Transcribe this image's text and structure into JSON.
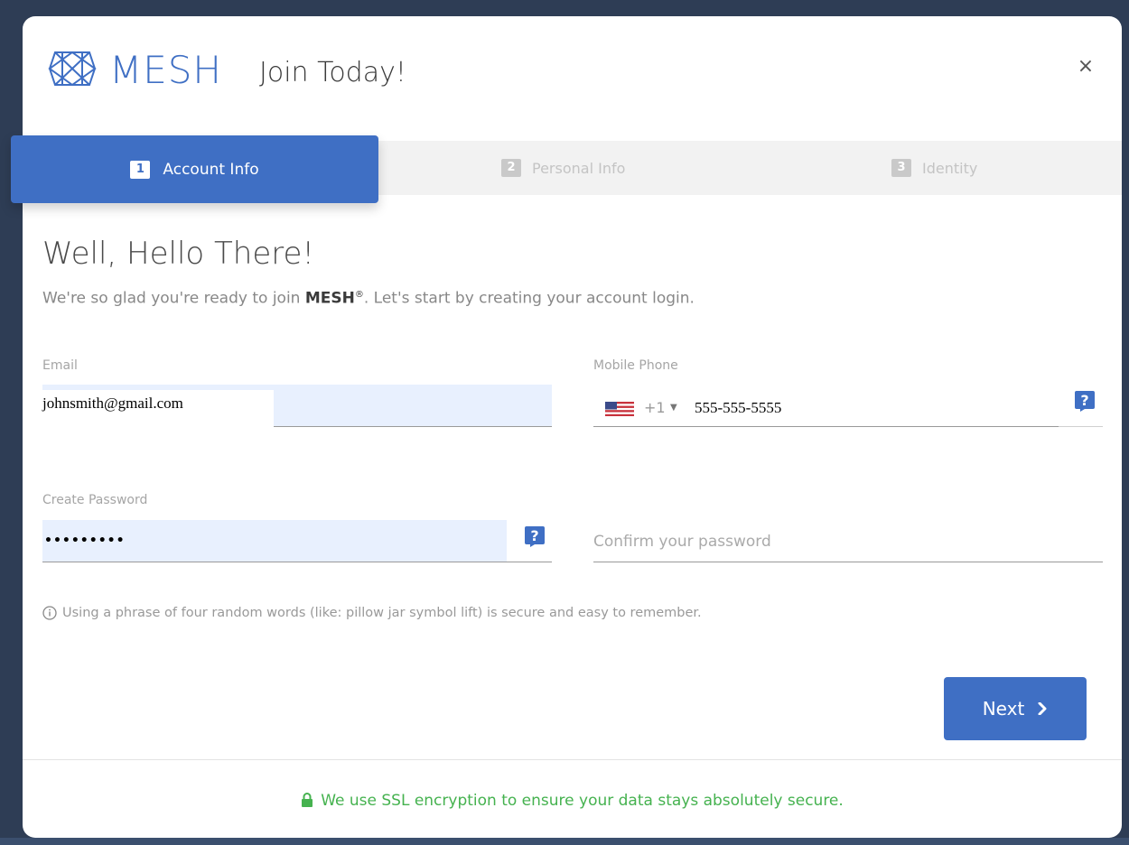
{
  "header": {
    "brand": "MESH",
    "title": "Join Today!",
    "close_label": "×"
  },
  "steps": [
    {
      "number": "1",
      "label": "Account Info",
      "active": true
    },
    {
      "number": "2",
      "label": "Personal Info",
      "active": false
    },
    {
      "number": "3",
      "label": "Identity",
      "active": false
    }
  ],
  "content": {
    "greeting": "Well, Hello There!",
    "intro_before": "We're so glad you're ready to join ",
    "intro_brand": "MESH",
    "intro_reg": "®",
    "intro_after": ". Let's start by creating your account login."
  },
  "form": {
    "email": {
      "label": "Email",
      "value": "johnsmith@gmail.com"
    },
    "phone": {
      "label": "Mobile Phone",
      "dial_code": "+1",
      "value": "555-555-5555",
      "country": "us-flag-icon"
    },
    "password": {
      "label": "Create Password",
      "value": "•••••••••"
    },
    "confirm": {
      "placeholder": "Confirm your password"
    },
    "hint": "Using a phrase of four random words (like: pillow jar symbol lift) is secure and easy to remember."
  },
  "actions": {
    "next_label": "Next"
  },
  "footer": {
    "ssl_text": "We use SSL encryption to ensure your data stays absolutely secure."
  },
  "colors": {
    "brand_blue": "#3f6fc4",
    "autofill_bg": "#e8f0fe",
    "ssl_green": "#45b24f",
    "backdrop": "#2e3d55"
  }
}
